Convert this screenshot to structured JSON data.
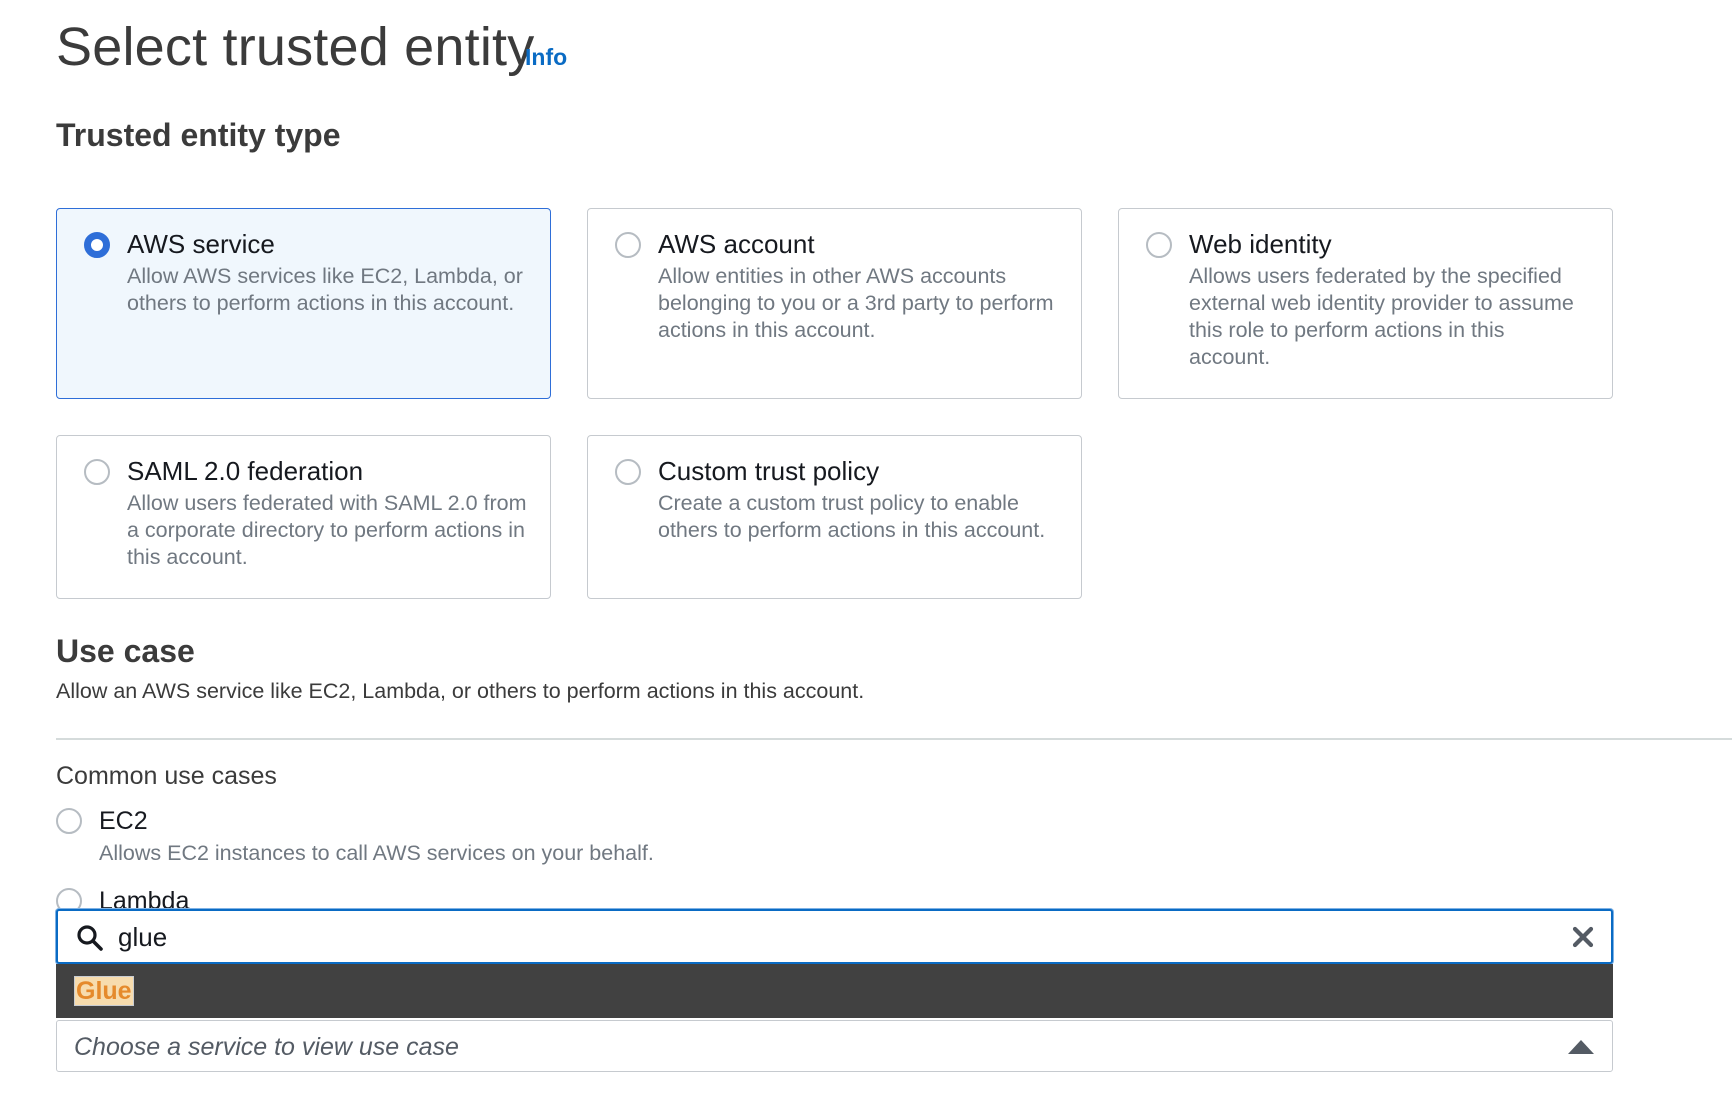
{
  "header": {
    "title": "Select trusted entity",
    "info_link": "Info"
  },
  "trusted_entity": {
    "heading": "Trusted entity type",
    "options": [
      {
        "title": "AWS service",
        "description": "Allow AWS services like EC2, Lambda, or others to perform actions in this account.",
        "selected": true
      },
      {
        "title": "AWS account",
        "description": "Allow entities in other AWS accounts belonging to you or a 3rd party to perform actions in this account.",
        "selected": false
      },
      {
        "title": "Web identity",
        "description": "Allows users federated by the specified external web identity provider to assume this role to perform actions in this account.",
        "selected": false
      },
      {
        "title": "SAML 2.0 federation",
        "description": "Allow users federated with SAML 2.0 from a corporate directory to perform actions in this account.",
        "selected": false
      },
      {
        "title": "Custom trust policy",
        "description": "Create a custom trust policy to enable others to perform actions in this account.",
        "selected": false
      }
    ]
  },
  "use_case": {
    "heading": "Use case",
    "description": "Allow an AWS service like EC2, Lambda, or others to perform actions in this account.",
    "common_label": "Common use cases",
    "common_options": [
      {
        "label": "EC2",
        "description": "Allows EC2 instances to call AWS services on your behalf.",
        "selected": false
      },
      {
        "label": "Lambda",
        "selected": false
      }
    ],
    "search": {
      "value": "glue"
    },
    "dropdown_results": [
      "Glue"
    ],
    "service_select": {
      "placeholder": "Choose a service to view use case"
    }
  },
  "colors": {
    "accent": "#2e6ed8",
    "link": "#0a6bc4",
    "selected_tile_bg": "#f0f7fd",
    "dropdown_bg": "#414141",
    "match_highlight": "#e58a2c"
  },
  "icons": {
    "search": "search-icon",
    "clear": "close-icon",
    "caret": "caret-up-icon"
  }
}
